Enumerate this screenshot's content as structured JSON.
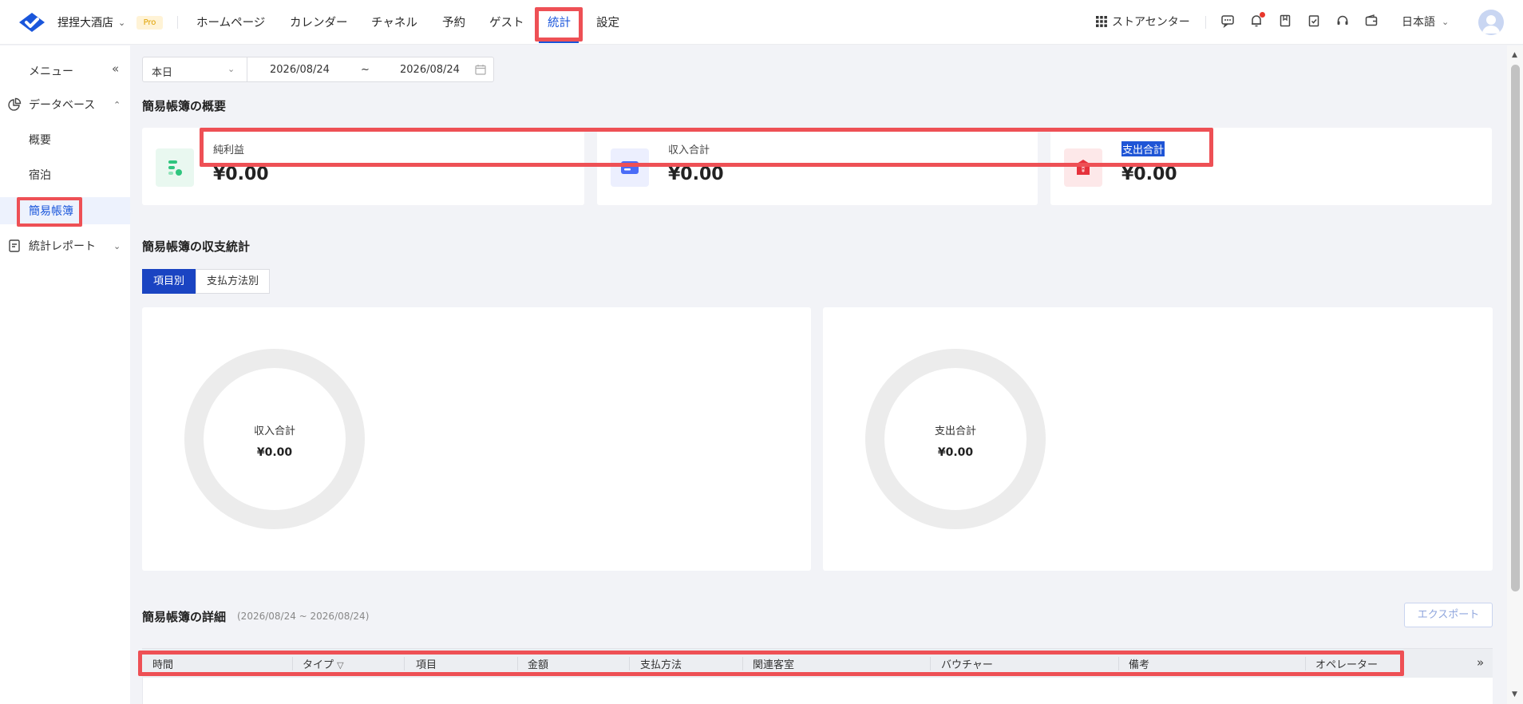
{
  "header": {
    "hotel_name": "捏捏大酒店",
    "pro_badge": "Pro",
    "nav": [
      "ホームページ",
      "カレンダー",
      "チャネル",
      "予約",
      "ゲスト",
      "統計",
      "設定"
    ],
    "active_nav": "統計",
    "store_center": "ストアセンター",
    "language": "日本語"
  },
  "sidebar": {
    "menu_label": "メニュー",
    "database": "データベース",
    "items": [
      "概要",
      "宿泊",
      "簡易帳簿"
    ],
    "active_item": "簡易帳簿",
    "reports": "統計レポート"
  },
  "filter": {
    "period": "本日",
    "start_date": "2026/08/24",
    "tilde": "~",
    "end_date": "2026/08/24"
  },
  "overview": {
    "title": "簡易帳簿の概要",
    "cards": [
      {
        "label": "純利益",
        "value": "¥0.00"
      },
      {
        "label": "収入合計",
        "value": "¥0.00"
      },
      {
        "label": "支出合計",
        "value": "¥0.00"
      }
    ]
  },
  "stats": {
    "title": "簡易帳簿の収支統計",
    "tabs": [
      "項目別",
      "支払方法別"
    ],
    "active_tab": "項目別",
    "income": {
      "label": "収入合計",
      "value": "¥0.00"
    },
    "expense": {
      "label": "支出合計",
      "value": "¥0.00"
    }
  },
  "detail": {
    "title": "簡易帳簿の詳細",
    "range": "(2026/08/24 ~ 2026/08/24)",
    "export": "エクスポート",
    "columns": [
      "時間",
      "タイプ",
      "項目",
      "金額",
      "支払方法",
      "関連客室",
      "バウチャー",
      "備考",
      "オペレーター"
    ]
  },
  "colors": {
    "accent": "#1a56db",
    "highlight": "#ee5055",
    "profit_icon": "#2fc57e",
    "income_icon": "#4a6cf7",
    "expense_icon": "#e6323c"
  }
}
